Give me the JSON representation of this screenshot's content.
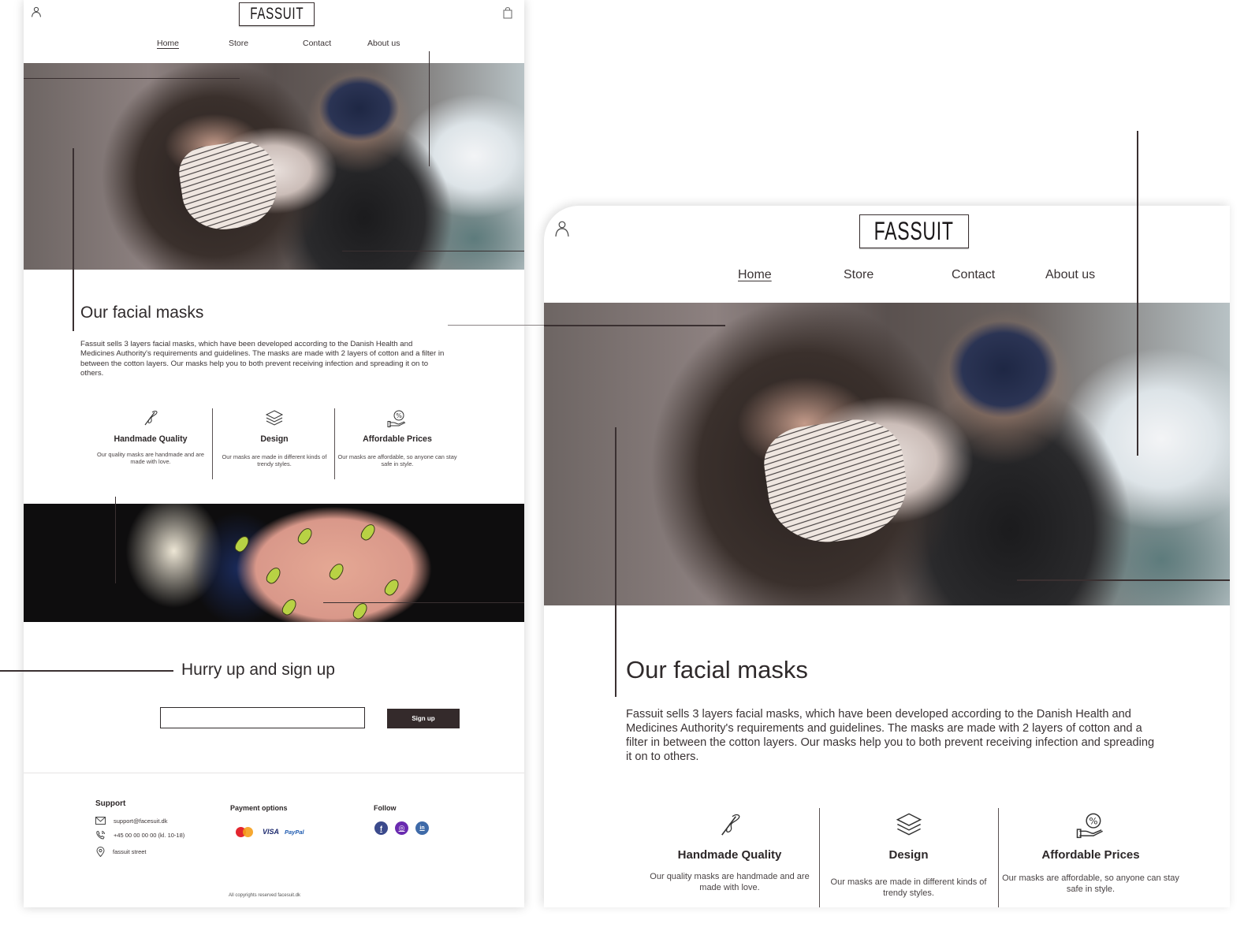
{
  "brand": {
    "logo_text": "FASSUIT",
    "accent_color": "#342a2b"
  },
  "nav": {
    "items": [
      {
        "label": "Home",
        "active": true
      },
      {
        "label": "Store",
        "active": false
      },
      {
        "label": "Contact",
        "active": false
      },
      {
        "label": "About us",
        "active": false
      }
    ]
  },
  "header_icons": {
    "user": "user-icon",
    "bag": "shopping-bag-icon"
  },
  "hero": {
    "image_alt": "Woman wearing a patterned fabric face mask with a man in a navy mask behind her"
  },
  "intro": {
    "title": "Our facial masks",
    "body": "Fassuit sells 3 layers facial masks, which have been developed according to the Danish Health and Medicines Authority's requirements and guidelines. The masks are made with 2 layers of cotton and a filter in between the cotton layers. Our masks help you to both prevent receiving infection and spreading it on to others."
  },
  "features": [
    {
      "icon": "needle-thread-icon",
      "title": "Handmade Quality",
      "desc": "Our quality masks are handmade and are made with love."
    },
    {
      "icon": "layers-icon",
      "title": "Design",
      "desc": "Our masks are made in different kinds of trendy styles."
    },
    {
      "icon": "percent-hand-icon",
      "title": "Affordable Prices",
      "desc": "Our masks are affordable, so anyone can stay safe in style."
    }
  ],
  "banner": {
    "image_alt": "Assorted fabric face masks including a pink banana print"
  },
  "signup": {
    "title": "Hurry up and sign up",
    "input_value": "",
    "input_placeholder": "",
    "button_label": "Sign up"
  },
  "footer": {
    "support": {
      "title": "Support",
      "email": "support@facesuit.dk",
      "phone": "+45 00 00 00 00 (kl. 10-18)",
      "address": "fassuit street"
    },
    "payment": {
      "title": "Payment options",
      "methods": [
        "MasterCard",
        "VISA",
        "PayPal"
      ]
    },
    "follow": {
      "title": "Follow",
      "networks": [
        {
          "name": "Facebook",
          "glyph": "f",
          "color": "#3b4a8c"
        },
        {
          "name": "Instagram",
          "glyph": "◎",
          "color": "#6a2bb0"
        },
        {
          "name": "LinkedIn",
          "glyph": "in",
          "color": "#3e6aa8"
        }
      ]
    },
    "copyright": "All copyrights reserved facesuit.dk"
  }
}
